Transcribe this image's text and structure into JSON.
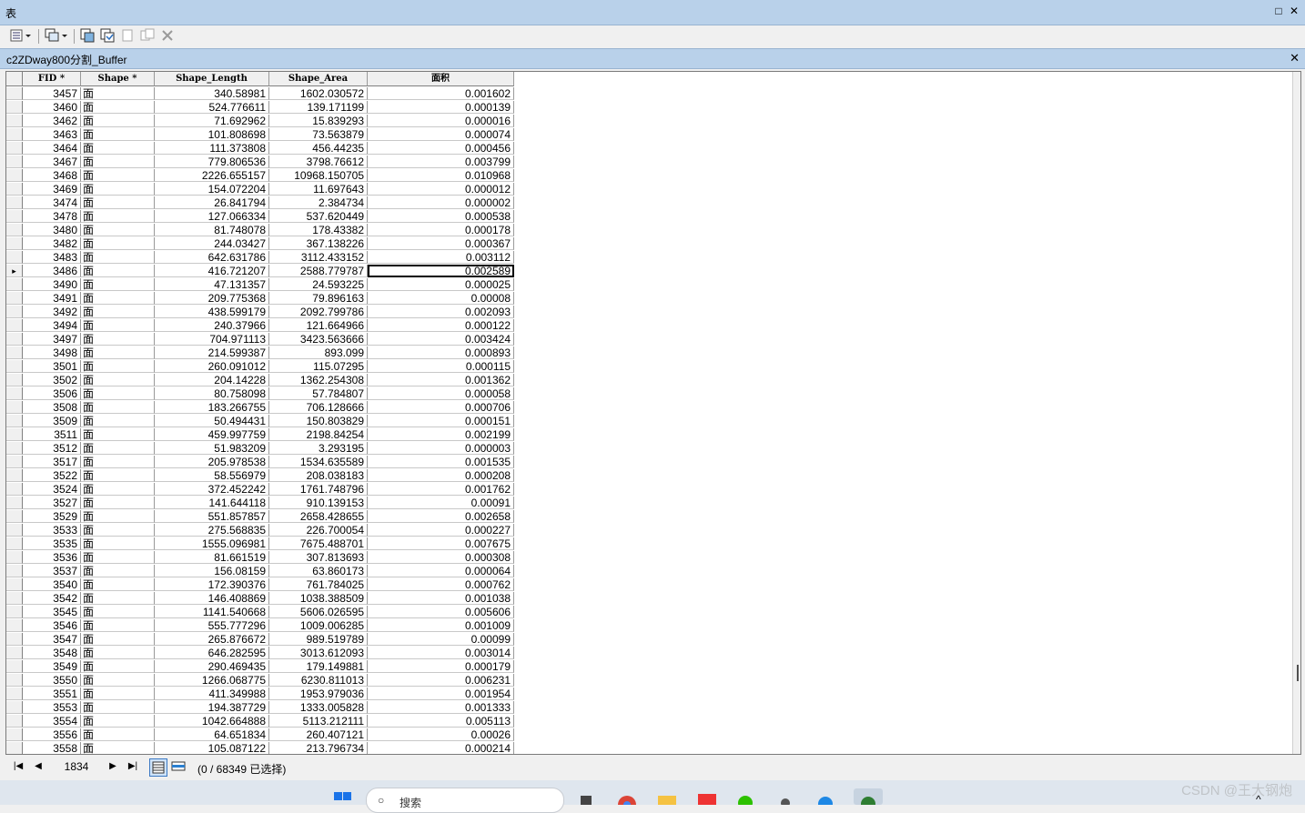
{
  "window": {
    "title": "表",
    "maximize": "□",
    "close": "✕"
  },
  "toolbar": {
    "table_options_icon": "table-options-icon",
    "related_tables_icon": "related-tables-icon",
    "select_by_attr_icon": "select-by-attributes-icon",
    "switch_selection_icon": "switch-selection-icon",
    "clear_selection_icon": "clear-selection-icon",
    "zoom_selected_icon": "zoom-to-selected-icon",
    "delete_icon": "delete-selected-icon"
  },
  "tab": {
    "name": "c2ZDway800分割_Buffer",
    "close": "✕"
  },
  "table": {
    "columns": [
      "FID *",
      "Shape *",
      "Shape_Length",
      "Shape_Area",
      "面积"
    ],
    "selected_row_index": 13,
    "rows": [
      [
        "3457",
        "面",
        "340.58981",
        "1602.030572",
        "0.001602"
      ],
      [
        "3460",
        "面",
        "524.776611",
        "139.171199",
        "0.000139"
      ],
      [
        "3462",
        "面",
        "71.692962",
        "15.839293",
        "0.000016"
      ],
      [
        "3463",
        "面",
        "101.808698",
        "73.563879",
        "0.000074"
      ],
      [
        "3464",
        "面",
        "111.373808",
        "456.44235",
        "0.000456"
      ],
      [
        "3467",
        "面",
        "779.806536",
        "3798.76612",
        "0.003799"
      ],
      [
        "3468",
        "面",
        "2226.655157",
        "10968.150705",
        "0.010968"
      ],
      [
        "3469",
        "面",
        "154.072204",
        "11.697643",
        "0.000012"
      ],
      [
        "3474",
        "面",
        "26.841794",
        "2.384734",
        "0.000002"
      ],
      [
        "3478",
        "面",
        "127.066334",
        "537.620449",
        "0.000538"
      ],
      [
        "3480",
        "面",
        "81.748078",
        "178.43382",
        "0.000178"
      ],
      [
        "3482",
        "面",
        "244.03427",
        "367.138226",
        "0.000367"
      ],
      [
        "3483",
        "面",
        "642.631786",
        "3112.433152",
        "0.003112"
      ],
      [
        "3486",
        "面",
        "416.721207",
        "2588.779787",
        "0.002589"
      ],
      [
        "3490",
        "面",
        "47.131357",
        "24.593225",
        "0.000025"
      ],
      [
        "3491",
        "面",
        "209.775368",
        "79.896163",
        "0.00008"
      ],
      [
        "3492",
        "面",
        "438.599179",
        "2092.799786",
        "0.002093"
      ],
      [
        "3494",
        "面",
        "240.37966",
        "121.664966",
        "0.000122"
      ],
      [
        "3497",
        "面",
        "704.971113",
        "3423.563666",
        "0.003424"
      ],
      [
        "3498",
        "面",
        "214.599387",
        "893.099",
        "0.000893"
      ],
      [
        "3501",
        "面",
        "260.091012",
        "115.07295",
        "0.000115"
      ],
      [
        "3502",
        "面",
        "204.14228",
        "1362.254308",
        "0.001362"
      ],
      [
        "3506",
        "面",
        "80.758098",
        "57.784807",
        "0.000058"
      ],
      [
        "3508",
        "面",
        "183.266755",
        "706.128666",
        "0.000706"
      ],
      [
        "3509",
        "面",
        "50.494431",
        "150.803829",
        "0.000151"
      ],
      [
        "3511",
        "面",
        "459.997759",
        "2198.84254",
        "0.002199"
      ],
      [
        "3512",
        "面",
        "51.983209",
        "3.293195",
        "0.000003"
      ],
      [
        "3517",
        "面",
        "205.978538",
        "1534.635589",
        "0.001535"
      ],
      [
        "3522",
        "面",
        "58.556979",
        "208.038183",
        "0.000208"
      ],
      [
        "3524",
        "面",
        "372.452242",
        "1761.748796",
        "0.001762"
      ],
      [
        "3527",
        "面",
        "141.644118",
        "910.139153",
        "0.00091"
      ],
      [
        "3529",
        "面",
        "551.857857",
        "2658.428655",
        "0.002658"
      ],
      [
        "3533",
        "面",
        "275.568835",
        "226.700054",
        "0.000227"
      ],
      [
        "3535",
        "面",
        "1555.096981",
        "7675.488701",
        "0.007675"
      ],
      [
        "3536",
        "面",
        "81.661519",
        "307.813693",
        "0.000308"
      ],
      [
        "3537",
        "面",
        "156.08159",
        "63.860173",
        "0.000064"
      ],
      [
        "3540",
        "面",
        "172.390376",
        "761.784025",
        "0.000762"
      ],
      [
        "3542",
        "面",
        "146.408869",
        "1038.388509",
        "0.001038"
      ],
      [
        "3545",
        "面",
        "1141.540668",
        "5606.026595",
        "0.005606"
      ],
      [
        "3546",
        "面",
        "555.777296",
        "1009.006285",
        "0.001009"
      ],
      [
        "3547",
        "面",
        "265.876672",
        "989.519789",
        "0.00099"
      ],
      [
        "3548",
        "面",
        "646.282595",
        "3013.612093",
        "0.003014"
      ],
      [
        "3549",
        "面",
        "290.469435",
        "179.149881",
        "0.000179"
      ],
      [
        "3550",
        "面",
        "1266.068775",
        "6230.811013",
        "0.006231"
      ],
      [
        "3551",
        "面",
        "411.349988",
        "1953.979036",
        "0.001954"
      ],
      [
        "3553",
        "面",
        "194.387729",
        "1333.005828",
        "0.001333"
      ],
      [
        "3554",
        "面",
        "1042.664888",
        "5113.212111",
        "0.005113"
      ],
      [
        "3556",
        "面",
        "64.651834",
        "260.407121",
        "0.00026"
      ],
      [
        "3558",
        "面",
        "105.087122",
        "213.796734",
        "0.000214"
      ]
    ]
  },
  "nav": {
    "first": "|◀",
    "prev": "◀",
    "record": "1834",
    "next": "▶",
    "last": "▶|",
    "selection_info": "(0 / 68349 已选择)"
  },
  "taskbar": {
    "search_label": "搜索"
  },
  "watermark": "CSDN @王大钢炮",
  "colors": {
    "titlebar": "#b9d1ea",
    "grid_bg": "#ffffff",
    "header_bg": "#f0f0f0"
  }
}
